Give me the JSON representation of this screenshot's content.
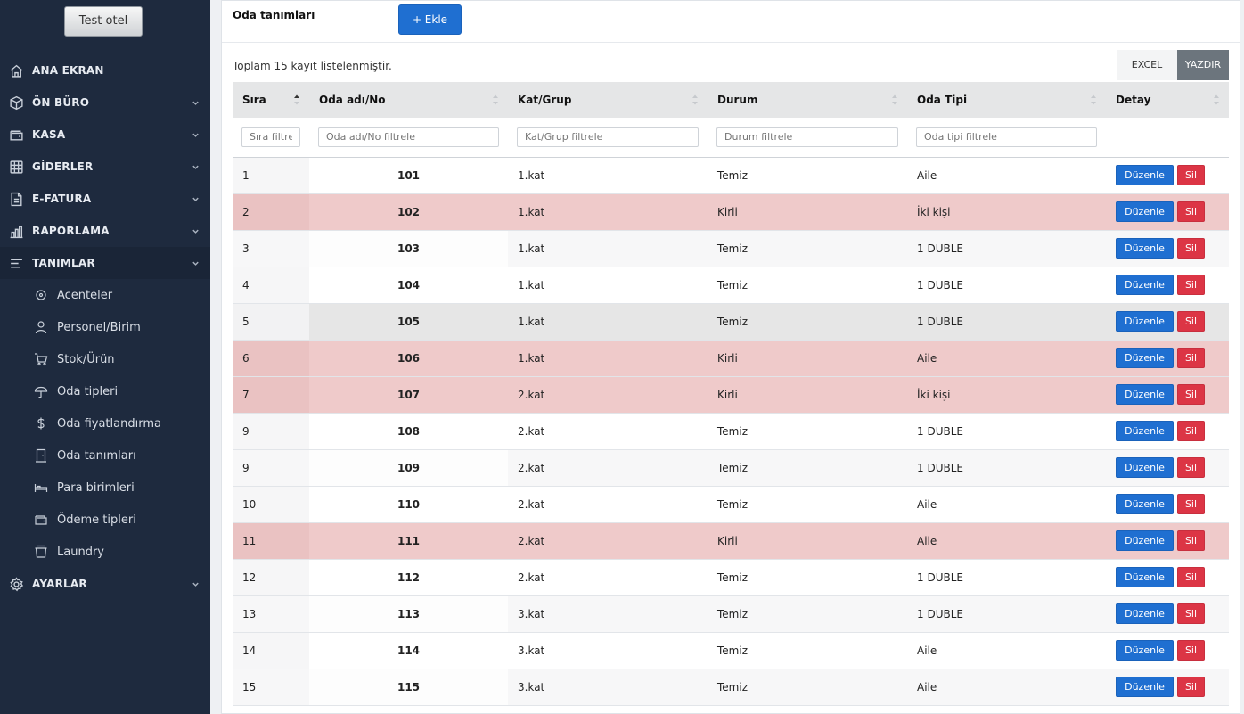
{
  "sidebar": {
    "hotel_button": "Test otel",
    "menu": [
      {
        "label": "ANA EKRAN",
        "icon": "home-icon",
        "has_chevron": false
      },
      {
        "label": "ÖN BÜRO",
        "icon": "box-icon",
        "has_chevron": true
      },
      {
        "label": "KASA",
        "icon": "wallet-icon",
        "has_chevron": true
      },
      {
        "label": "GİDERLER",
        "icon": "grid-icon",
        "has_chevron": true
      },
      {
        "label": "E-FATURA",
        "icon": "invoice-icon",
        "has_chevron": true
      },
      {
        "label": "RAPORLAMA",
        "icon": "bar-chart-icon",
        "has_chevron": true
      },
      {
        "label": "TANIMLAR",
        "icon": "list-icon",
        "has_chevron": true
      },
      {
        "label": "AYARLAR",
        "icon": "gear-icon",
        "has_chevron": true
      }
    ],
    "submenu": [
      {
        "label": "Acenteler",
        "icon": "target-icon"
      },
      {
        "label": "Personel/Birim",
        "icon": "user-icon"
      },
      {
        "label": "Stok/Ürün",
        "icon": "cart-icon"
      },
      {
        "label": "Oda tipleri",
        "icon": "umbrella-icon"
      },
      {
        "label": "Oda fiyatlandırma",
        "icon": "dollar-icon"
      },
      {
        "label": "Oda tanımları",
        "icon": "door-icon"
      },
      {
        "label": "Para birimleri",
        "icon": "bed-icon"
      },
      {
        "label": "Ödeme tipleri",
        "icon": "wallet-icon"
      },
      {
        "label": "Laundry",
        "icon": "basket-icon"
      }
    ]
  },
  "header": {
    "title": "Oda tanımları",
    "add_button": "+ Ekle"
  },
  "toolbar": {
    "total_text": "Toplam 15 kayıt listelenmiştir.",
    "excel": "EXCEL",
    "print": "YAZDIR"
  },
  "table": {
    "columns": [
      "Sıra",
      "Oda adı/No",
      "Kat/Grup",
      "Durum",
      "Oda Tipi",
      "Detay"
    ],
    "filters": [
      "Sıra filtrele",
      "Oda adı/No filtrele",
      "Kat/Grup filtrele",
      "Durum filtrele",
      "Oda tipi filtrele"
    ],
    "edit_label": "Düzenle",
    "delete_label": "Sil",
    "rows": [
      {
        "sira": "1",
        "room": "101",
        "floor": "1.kat",
        "status": "Temiz",
        "type": "Aile"
      },
      {
        "sira": "2",
        "room": "102",
        "floor": "1.kat",
        "status": "Kirli",
        "type": "İki kişi"
      },
      {
        "sira": "3",
        "room": "103",
        "floor": "1.kat",
        "status": "Temiz",
        "type": "1 DUBLE"
      },
      {
        "sira": "4",
        "room": "104",
        "floor": "1.kat",
        "status": "Temiz",
        "type": "1 DUBLE"
      },
      {
        "sira": "5",
        "room": "105",
        "floor": "1.kat",
        "status": "Temiz",
        "type": "1 DUBLE"
      },
      {
        "sira": "6",
        "room": "106",
        "floor": "1.kat",
        "status": "Kirli",
        "type": "Aile"
      },
      {
        "sira": "7",
        "room": "107",
        "floor": "2.kat",
        "status": "Kirli",
        "type": "İki kişi"
      },
      {
        "sira": "9",
        "room": "108",
        "floor": "2.kat",
        "status": "Temiz",
        "type": "1 DUBLE"
      },
      {
        "sira": "9",
        "room": "109",
        "floor": "2.kat",
        "status": "Temiz",
        "type": "1 DUBLE"
      },
      {
        "sira": "10",
        "room": "110",
        "floor": "2.kat",
        "status": "Temiz",
        "type": "Aile"
      },
      {
        "sira": "11",
        "room": "111",
        "floor": "2.kat",
        "status": "Kirli",
        "type": "Aile"
      },
      {
        "sira": "12",
        "room": "112",
        "floor": "2.kat",
        "status": "Temiz",
        "type": "1 DUBLE"
      },
      {
        "sira": "13",
        "room": "113",
        "floor": "3.kat",
        "status": "Temiz",
        "type": "1 DUBLE"
      },
      {
        "sira": "14",
        "room": "114",
        "floor": "3.kat",
        "status": "Temiz",
        "type": "Aile"
      },
      {
        "sira": "15",
        "room": "115",
        "floor": "3.kat",
        "status": "Temiz",
        "type": "Aile"
      }
    ]
  }
}
